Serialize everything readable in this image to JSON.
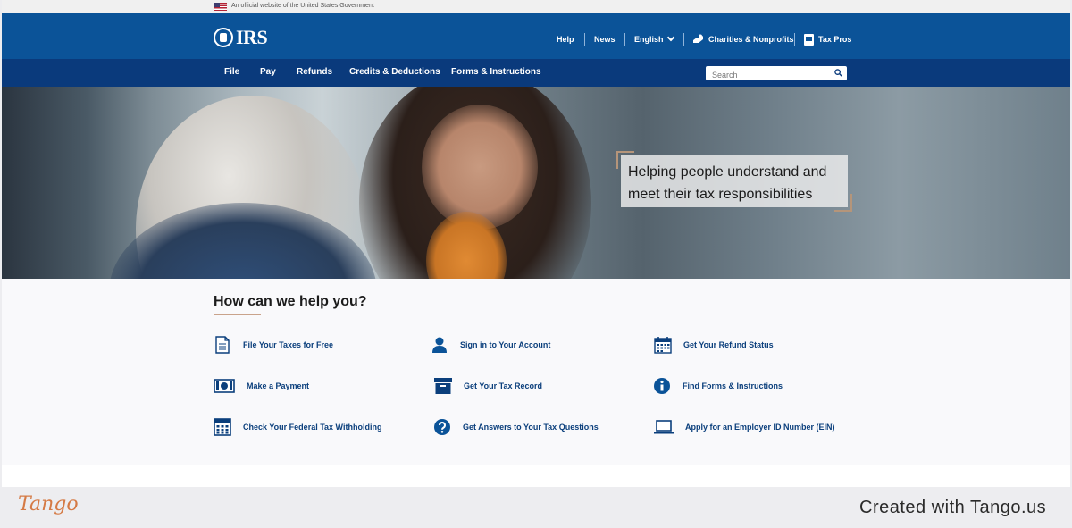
{
  "gov_banner": {
    "text": "An official website of the United States Government"
  },
  "header": {
    "logo_text": "IRS",
    "utility_links": [
      "Help",
      "News",
      "English",
      "Charities & Nonprofits",
      "Tax Pros"
    ]
  },
  "nav": {
    "items": [
      "File",
      "Pay",
      "Refunds",
      "Credits & Deductions",
      "Forms & Instructions"
    ],
    "search_placeholder": "Search"
  },
  "hero": {
    "caption_line1": "Helping people understand and",
    "caption_line2": "meet their tax responsibilities"
  },
  "help": {
    "title": "How can we help you?",
    "links": [
      {
        "label": "File Your Taxes for Free",
        "icon": "document-icon"
      },
      {
        "label": "Sign in to Your Account",
        "icon": "user-icon"
      },
      {
        "label": "Get Your Refund Status",
        "icon": "calendar-icon"
      },
      {
        "label": "Make a Payment",
        "icon": "money-icon"
      },
      {
        "label": "Get Your Tax Record",
        "icon": "archive-box-icon"
      },
      {
        "label": "Find Forms & Instructions",
        "icon": "info-icon"
      },
      {
        "label": "Check Your Federal Tax Withholding",
        "icon": "calculator-icon"
      },
      {
        "label": "Get Answers to Your Tax Questions",
        "icon": "question-icon"
      },
      {
        "label": "Apply for an Employer ID Number (EIN)",
        "icon": "laptop-icon"
      }
    ]
  },
  "footer": {
    "brand": "Tango",
    "credit": "Created with Tango.us"
  },
  "colors": {
    "header": "#0b5398",
    "nav": "#0a3a7c",
    "link": "#0b3f7c",
    "accent": "#c9a38b",
    "tango": "#d57a45"
  }
}
